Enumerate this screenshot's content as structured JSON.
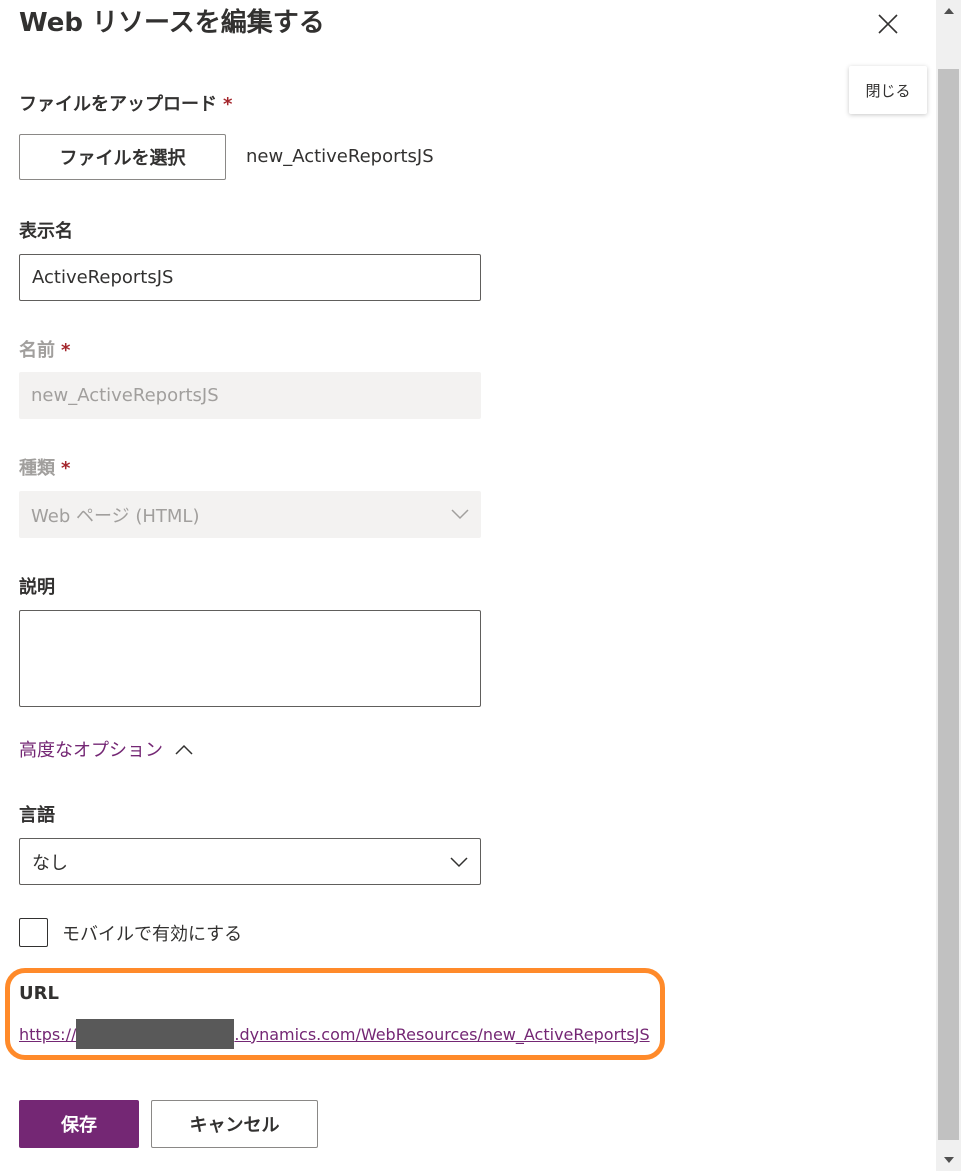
{
  "dialog": {
    "title": "Web リソースを編集する",
    "close_tooltip": "閉じる"
  },
  "upload": {
    "label": "ファイルをアップロード",
    "required_mark": "*",
    "button_label": "ファイルを選択",
    "file_name": "new_ActiveReportsJS"
  },
  "display_name": {
    "label": "表示名",
    "value": "ActiveReportsJS"
  },
  "name": {
    "label": "名前",
    "required_mark": "*",
    "value": "new_ActiveReportsJS"
  },
  "type": {
    "label": "種類",
    "required_mark": "*",
    "value": "Web ページ (HTML)"
  },
  "description": {
    "label": "説明",
    "value": ""
  },
  "advanced": {
    "label": "高度なオプション"
  },
  "language": {
    "label": "言語",
    "value": "なし"
  },
  "mobile": {
    "label": "モバイルで有効にする",
    "checked": false
  },
  "url": {
    "label": "URL",
    "prefix": "https://",
    "suffix": ".dynamics.com/WebResources/new_ActiveReportsJS"
  },
  "actions": {
    "save_label": "保存",
    "cancel_label": "キャンセル"
  },
  "colors": {
    "accent": "#742774",
    "required": "#a4262c",
    "highlight": "#ff8a2a"
  }
}
